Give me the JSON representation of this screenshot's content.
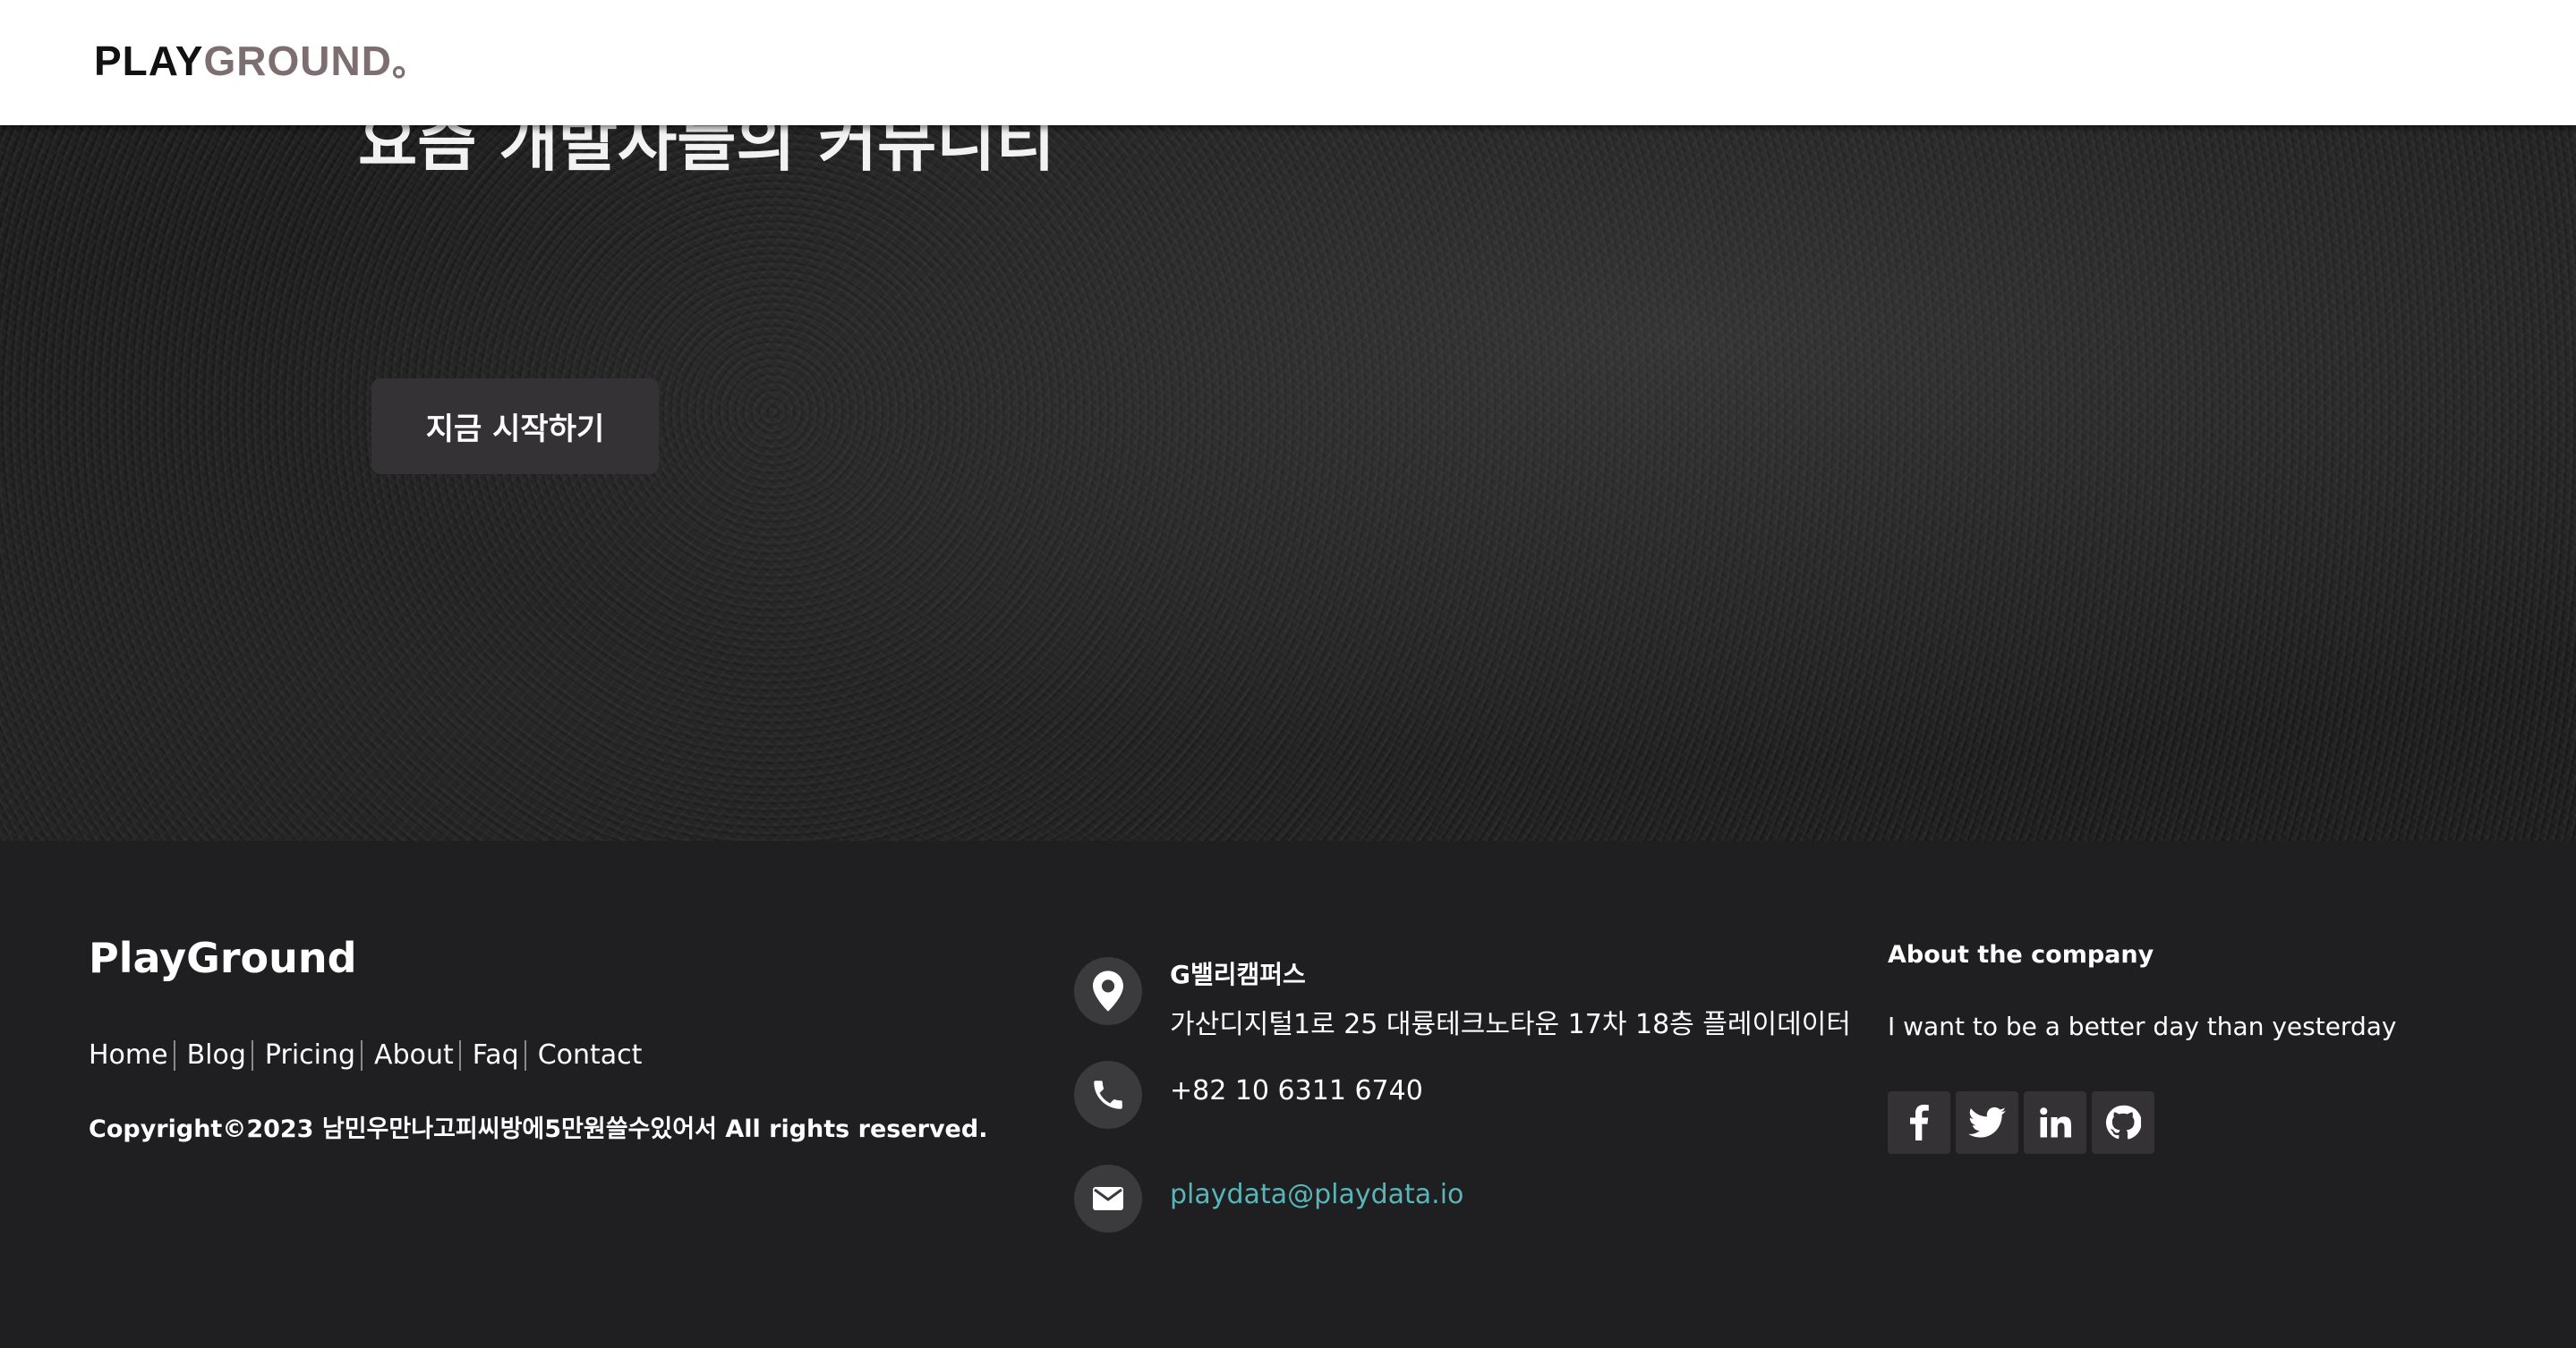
{
  "header": {
    "logo_part1": "PLAY",
    "logo_part2": "GROUND",
    "logo_part3": "。"
  },
  "hero": {
    "title": "요즘 개발자들의 커뮤니티",
    "start_button": "지금 시작하기"
  },
  "footer": {
    "brand": "PlayGround",
    "nav": [
      "Home",
      "Blog",
      "Pricing",
      "About",
      "Faq",
      "Contact"
    ],
    "copyright": "Copyright©2023 남민우만나고피씨방에5만원쓸수있어서 All rights reserved.",
    "address_name": "G밸리캠퍼스",
    "address_line": "가산디지털1로 25 대륭테크노타운 17차 18층 플레이데이터",
    "phone": "+82 10 6311 6740",
    "email": "playdata@playdata.io",
    "about_title": "About the company",
    "about_text": "I want to be a better day than yesterday",
    "social_icons": [
      "facebook-icon",
      "twitter-icon",
      "linkedin-icon",
      "github-icon"
    ]
  },
  "colors": {
    "footer_bg": "#1f1e20",
    "logo_accent": "#7d6f70",
    "email_link": "#58b5b8",
    "button_bg": "#343234"
  }
}
